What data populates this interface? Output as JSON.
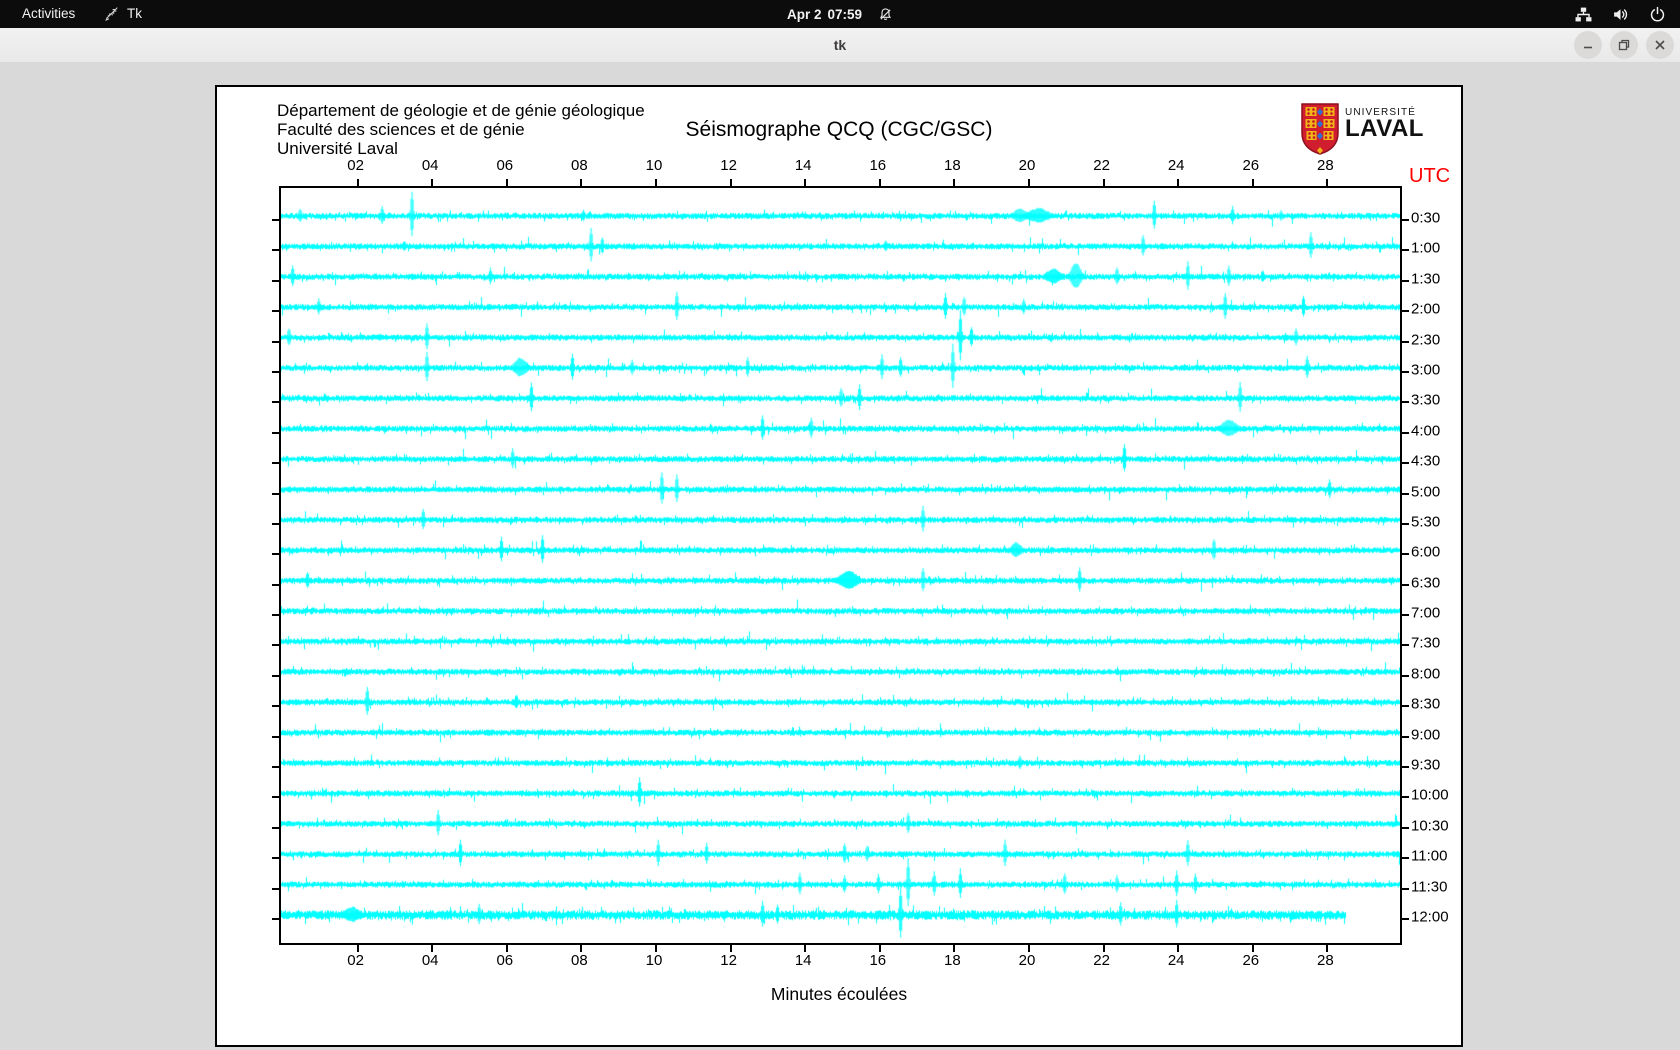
{
  "topbar": {
    "activities": "Activities",
    "app_name": "Tk",
    "clock_date": "Apr 2",
    "clock_time": "07:59",
    "icons": [
      "tk-feather-icon",
      "dnd-bell-slash-icon",
      "network-wired-icon",
      "volume-icon",
      "power-icon"
    ]
  },
  "titlebar": {
    "title": "tk",
    "buttons": [
      "minimize",
      "maximize",
      "close"
    ]
  },
  "canvas_header": {
    "line1": "Département de géologie et de génie géologique",
    "line2": "Faculté des sciences et de génie",
    "line3": "Université Laval",
    "title": "Séismographe QCQ (CGC/GSC)"
  },
  "logo": {
    "line1": "UNIVERSITÉ",
    "line2": "LAVAL",
    "shield_red": "#d01e2f",
    "shield_gold": "#f2b417",
    "shield_blue": "#2e6fd0"
  },
  "chart_data": {
    "type": "line",
    "subtype": "seismogram-helicorder",
    "title": "Séismographe QCQ (CGC/GSC)",
    "xlabel": "Minutes écoulées",
    "time_axis_label": "UTC",
    "utc_color": "#ff0000",
    "trace_color": "#00ffff",
    "x_range_minutes": [
      0,
      30
    ],
    "x_tick_minutes": [
      2,
      4,
      6,
      8,
      10,
      12,
      14,
      16,
      18,
      20,
      22,
      24,
      26,
      28
    ],
    "x_tick_labels": [
      "02",
      "04",
      "06",
      "08",
      "10",
      "12",
      "14",
      "16",
      "18",
      "20",
      "22",
      "24",
      "26",
      "28"
    ],
    "row_labels": [
      "0:30",
      "1:00",
      "1:30",
      "2:00",
      "2:30",
      "3:00",
      "3:30",
      "4:00",
      "4:30",
      "5:00",
      "5:30",
      "6:00",
      "6:30",
      "7:00",
      "7:30",
      "8:00",
      "8:30",
      "9:00",
      "9:30",
      "10:00",
      "10:30",
      "11:00",
      "11:30",
      "12:00"
    ],
    "rows": [
      {
        "label": "0:30",
        "end_minute": 30,
        "spikes": [
          [
            0.5,
            7
          ],
          [
            2.7,
            9
          ],
          [
            3.5,
            24
          ],
          [
            8.1,
            5
          ],
          [
            19.8,
            6,
            6
          ],
          [
            20.3,
            7,
            8
          ],
          [
            23.4,
            15
          ],
          [
            25.5,
            9
          ],
          [
            26.8,
            5
          ]
        ]
      },
      {
        "label": "1:00",
        "end_minute": 30,
        "spikes": [
          [
            3.3,
            5
          ],
          [
            8.3,
            17
          ],
          [
            8.6,
            8
          ],
          [
            16.2,
            5
          ],
          [
            23.1,
            10
          ],
          [
            27.6,
            13
          ]
        ]
      },
      {
        "label": "1:30",
        "end_minute": 30,
        "spikes": [
          [
            0.3,
            11
          ],
          [
            5.6,
            8
          ],
          [
            20.7,
            7,
            6
          ],
          [
            21.3,
            13,
            4
          ],
          [
            22.4,
            8
          ],
          [
            24.3,
            15
          ],
          [
            25.4,
            10
          ],
          [
            26.3,
            6
          ]
        ]
      },
      {
        "label": "2:00",
        "end_minute": 30,
        "spikes": [
          [
            1.0,
            8
          ],
          [
            10.6,
            15
          ],
          [
            17.8,
            13
          ],
          [
            18.3,
            10
          ],
          [
            19.9,
            8
          ],
          [
            25.3,
            13
          ],
          [
            27.4,
            11
          ]
        ]
      },
      {
        "label": "2:30",
        "end_minute": 30,
        "spikes": [
          [
            0.2,
            9
          ],
          [
            3.9,
            13
          ],
          [
            18.2,
            27
          ],
          [
            18.5,
            10
          ],
          [
            27.2,
            9
          ]
        ]
      },
      {
        "label": "3:00",
        "end_minute": 30,
        "spikes": [
          [
            3.9,
            15
          ],
          [
            6.4,
            9,
            5
          ],
          [
            7.8,
            13
          ],
          [
            9.4,
            7
          ],
          [
            12.5,
            10
          ],
          [
            16.1,
            13
          ],
          [
            16.6,
            10
          ],
          [
            18.0,
            23
          ],
          [
            27.5,
            11
          ]
        ]
      },
      {
        "label": "3:30",
        "end_minute": 30,
        "spikes": [
          [
            6.7,
            15
          ],
          [
            15.0,
            10
          ],
          [
            15.5,
            13
          ],
          [
            25.7,
            15
          ]
        ]
      },
      {
        "label": "4:00",
        "end_minute": 30,
        "spikes": [
          [
            12.9,
            13
          ],
          [
            14.2,
            10
          ],
          [
            25.4,
            8,
            6
          ]
        ]
      },
      {
        "label": "4:30",
        "end_minute": 30,
        "spikes": [
          [
            6.2,
            10
          ],
          [
            22.6,
            15
          ]
        ]
      },
      {
        "label": "5:00",
        "end_minute": 30,
        "spikes": [
          [
            10.2,
            17
          ],
          [
            10.6,
            14
          ],
          [
            28.1,
            9
          ]
        ]
      },
      {
        "label": "5:30",
        "end_minute": 30,
        "spikes": [
          [
            3.8,
            10
          ],
          [
            17.2,
            13
          ]
        ]
      },
      {
        "label": "6:00",
        "end_minute": 30,
        "spikes": [
          [
            5.9,
            13
          ],
          [
            7.0,
            15
          ],
          [
            19.7,
            7,
            4
          ],
          [
            25.0,
            11
          ]
        ]
      },
      {
        "label": "6:30",
        "end_minute": 30,
        "spikes": [
          [
            0.7,
            8
          ],
          [
            15.2,
            9,
            7
          ],
          [
            17.2,
            12
          ],
          [
            21.4,
            13
          ]
        ]
      },
      {
        "label": "7:00",
        "end_minute": 30,
        "spikes": []
      },
      {
        "label": "7:30",
        "end_minute": 30,
        "spikes": []
      },
      {
        "label": "8:00",
        "end_minute": 30,
        "spikes": []
      },
      {
        "label": "8:30",
        "end_minute": 30,
        "spikes": [
          [
            2.3,
            15
          ],
          [
            6.3,
            7
          ]
        ]
      },
      {
        "label": "9:00",
        "end_minute": 30,
        "spikes": []
      },
      {
        "label": "9:30",
        "end_minute": 30,
        "spikes": [
          [
            19.8,
            7
          ]
        ]
      },
      {
        "label": "10:00",
        "end_minute": 30,
        "spikes": [
          [
            9.6,
            15
          ]
        ]
      },
      {
        "label": "10:30",
        "end_minute": 30,
        "spikes": [
          [
            4.2,
            13
          ],
          [
            16.8,
            10
          ]
        ]
      },
      {
        "label": "11:00",
        "end_minute": 30,
        "spikes": [
          [
            4.8,
            13
          ],
          [
            10.1,
            13
          ],
          [
            11.4,
            11
          ],
          [
            15.1,
            10
          ],
          [
            15.7,
            8
          ],
          [
            19.4,
            13
          ],
          [
            24.3,
            13
          ]
        ]
      },
      {
        "label": "11:30",
        "end_minute": 30,
        "spikes": [
          [
            13.9,
            11
          ],
          [
            15.1,
            8
          ],
          [
            16.0,
            10
          ],
          [
            16.8,
            25
          ],
          [
            17.5,
            12
          ],
          [
            18.2,
            15
          ],
          [
            21.0,
            10
          ],
          [
            22.4,
            8
          ],
          [
            24.0,
            13
          ],
          [
            24.5,
            10
          ]
        ]
      },
      {
        "label": "12:00",
        "end_minute": 28.55,
        "thick": true,
        "spikes": [
          [
            1.9,
            7,
            7
          ],
          [
            5.3,
            10
          ],
          [
            12.9,
            13
          ],
          [
            13.3,
            10
          ],
          [
            16.6,
            27
          ],
          [
            22.5,
            12
          ],
          [
            24.0,
            14
          ]
        ]
      }
    ]
  }
}
